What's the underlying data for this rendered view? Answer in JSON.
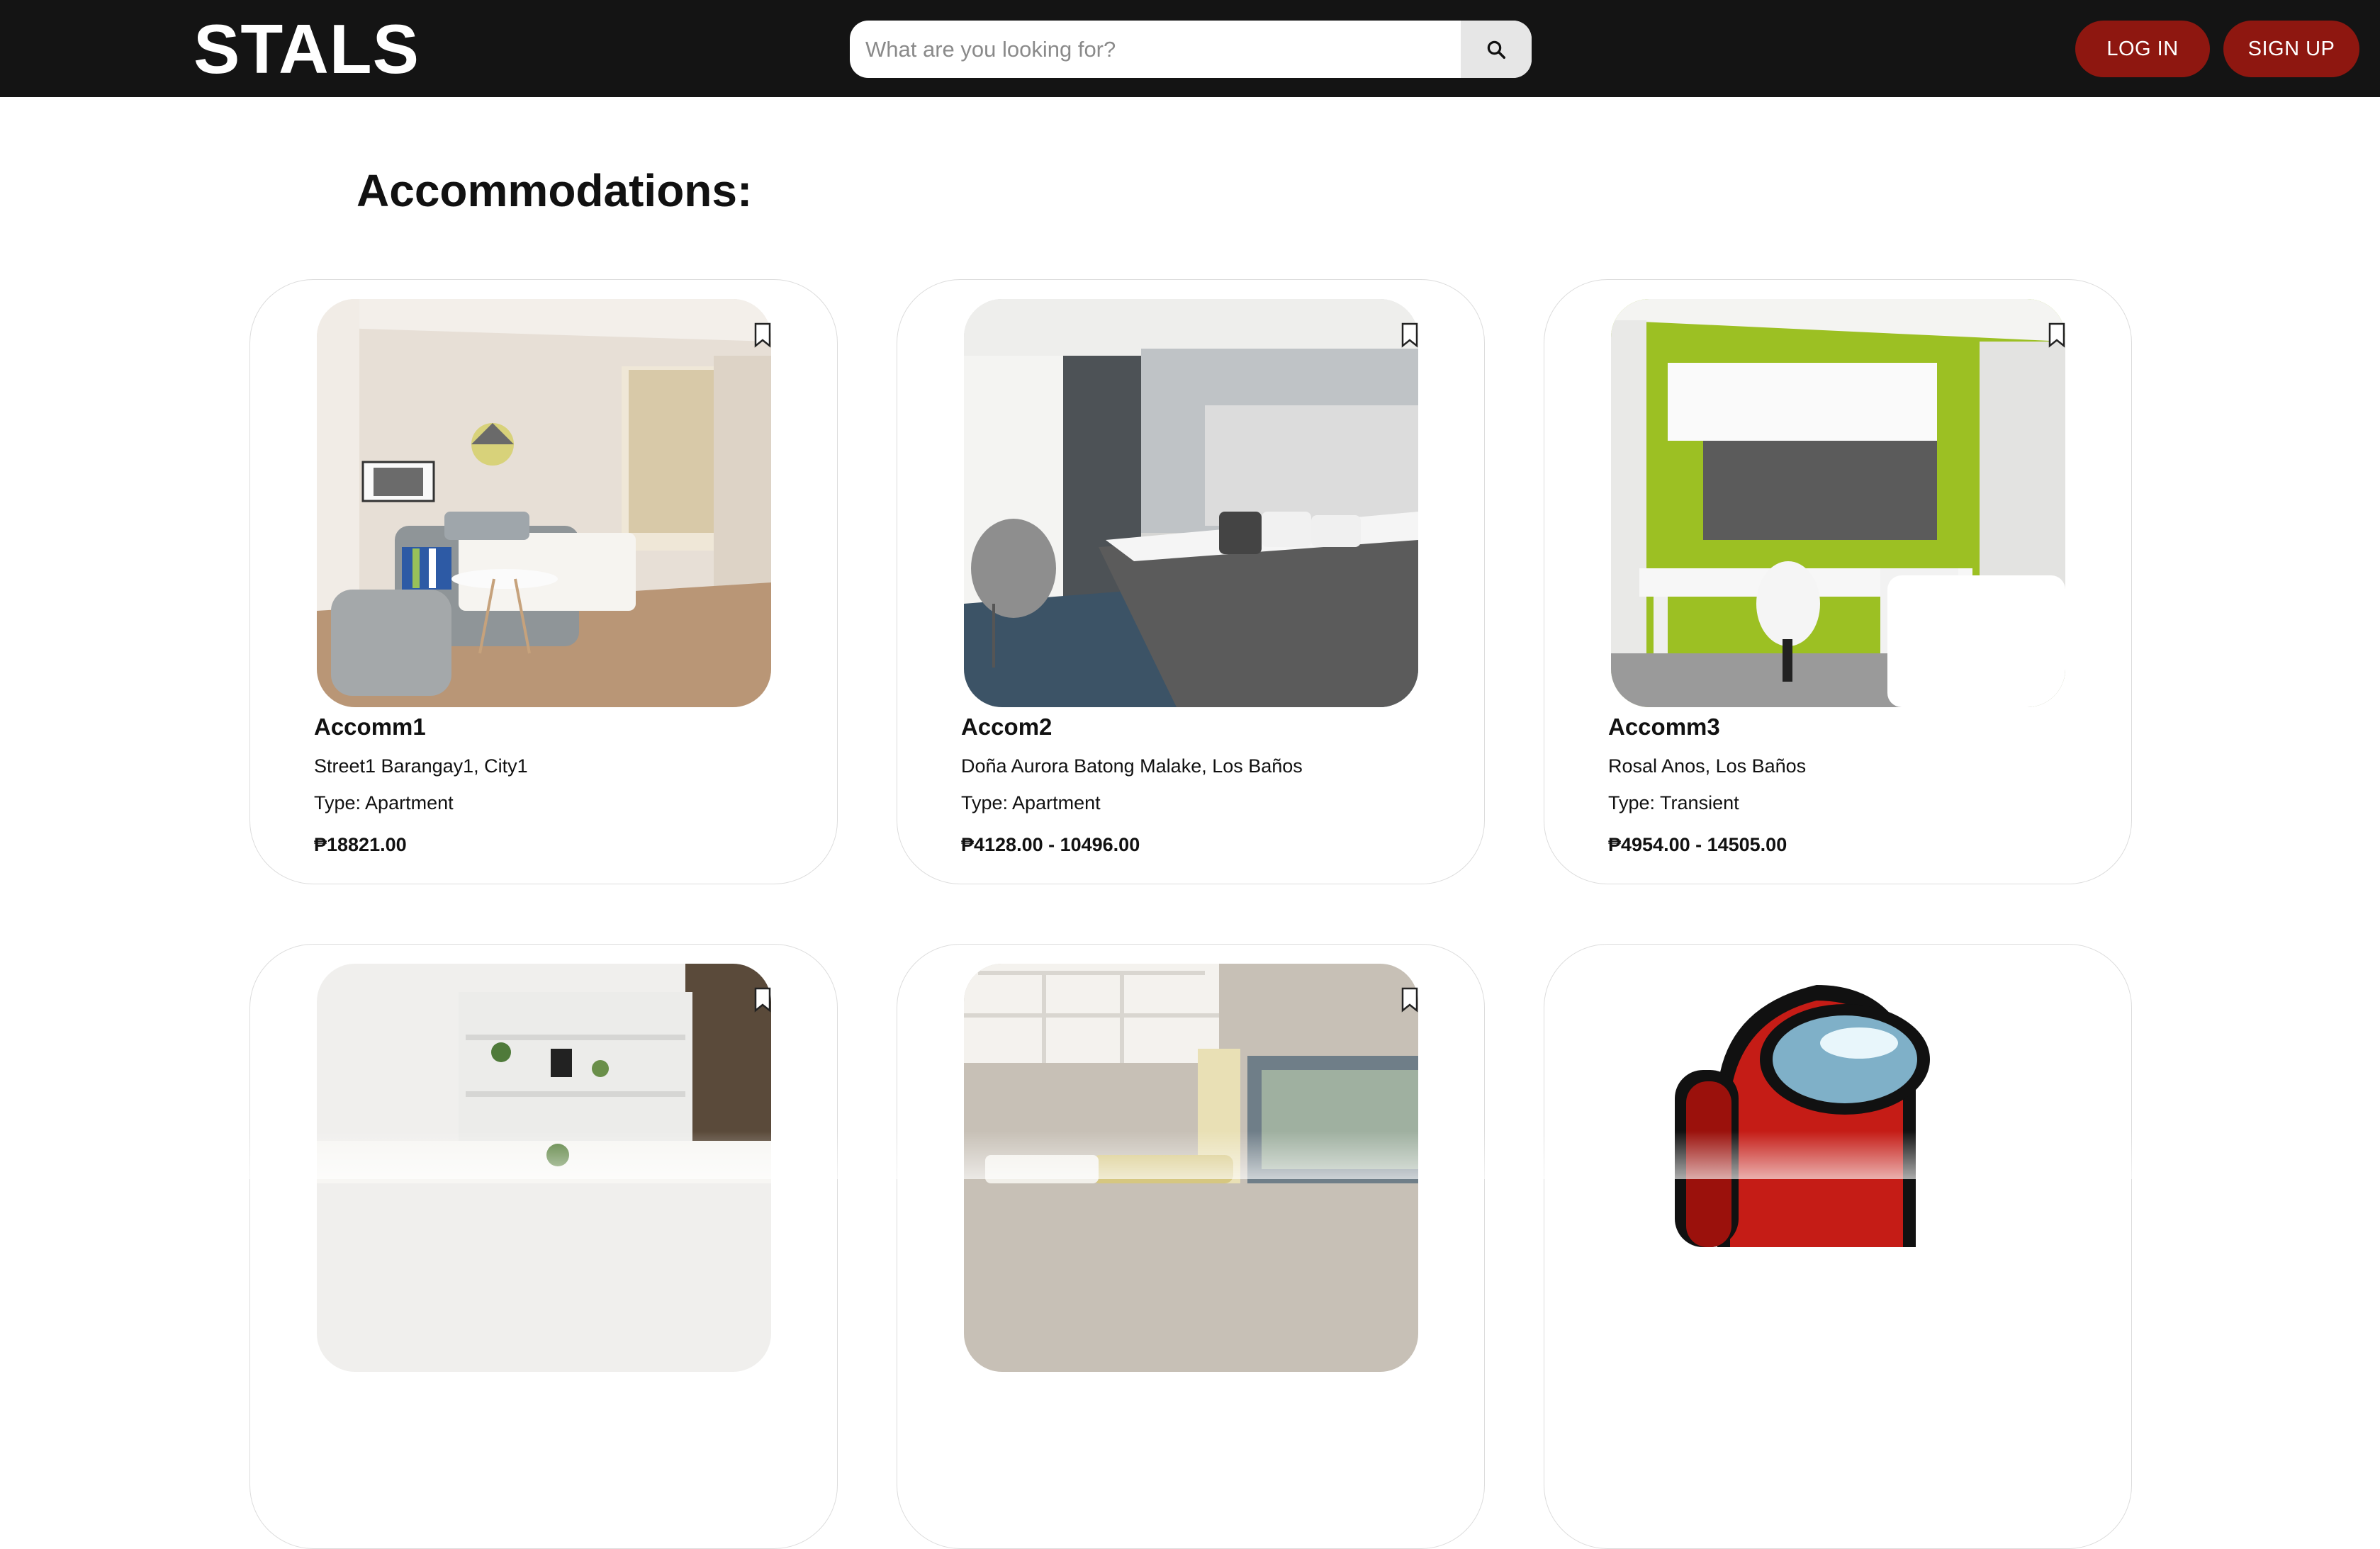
{
  "header": {
    "logo": "STALS",
    "search_placeholder": "What are you looking for?",
    "search_icon": "search-icon",
    "login_label": "LOG IN",
    "signup_label": "SIGN UP",
    "accent_color": "#8e1710"
  },
  "main": {
    "title": "Accommodations:",
    "cards": [
      {
        "name": "Accomm1",
        "address": "Street1 Barangay1, City1",
        "type": "Type: Apartment",
        "price": "₱18821.00"
      },
      {
        "name": "Accom2",
        "address": "Doña Aurora Batong Malake, Los Baños",
        "type": "Type: Apartment",
        "price": "₱4128.00 - 10496.00"
      },
      {
        "name": "Accomm3",
        "address": "Rosal Anos, Los Baños",
        "type": "Type: Transient",
        "price": "₱4954.00 - 14505.00"
      }
    ]
  }
}
